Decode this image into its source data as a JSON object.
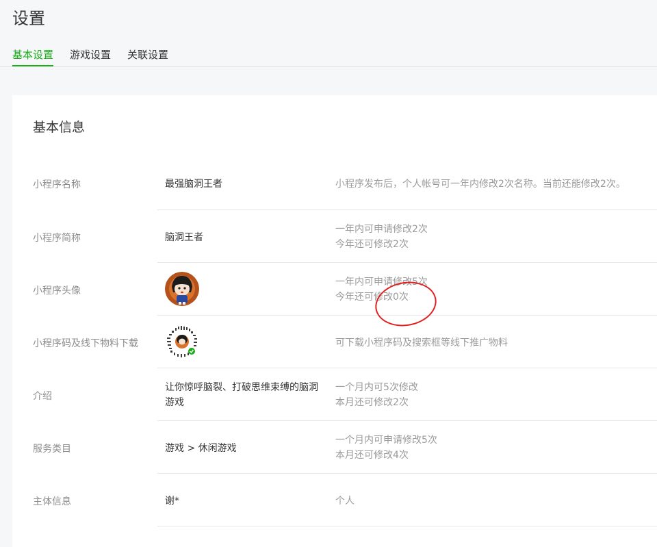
{
  "page": {
    "title": "设置"
  },
  "tabs": [
    {
      "label": "基本设置",
      "active": true
    },
    {
      "label": "游戏设置",
      "active": false
    },
    {
      "label": "关联设置",
      "active": false
    }
  ],
  "card": {
    "title": "基本信息",
    "rows": [
      {
        "label": "小程序名称",
        "value": "最强脑洞王者",
        "note": [
          "小程序发布后，个人帐号可一年内修改2次名称。当前还能修改2次。"
        ]
      },
      {
        "label": "小程序简称",
        "value": "脑洞王者",
        "note": [
          "一年内可申请修改2次",
          "今年还可修改2次"
        ]
      },
      {
        "label": "小程序头像",
        "value_icon": "cartoon-avatar",
        "note": [
          "一年内可申请修改5次",
          "今年还可修改0次"
        ]
      },
      {
        "label": "小程序码及线下物料下载",
        "value_icon": "mini-program-code",
        "note": [
          "可下载小程序码及搜索框等线下推广物料"
        ]
      },
      {
        "label": "介绍",
        "value_lines": [
          "让你惊呼脑裂、打破思维束缚的脑洞",
          "游戏"
        ],
        "note": [
          "一个月内可5次修改",
          "本月还可修改2次"
        ]
      },
      {
        "label": "服务类目",
        "value": "游戏 > 休闲游戏",
        "note": [
          "一个月内可申请修改5次",
          "本月还可修改4次"
        ]
      },
      {
        "label": "主体信息",
        "value": "谢*",
        "note": [
          "个人"
        ]
      }
    ]
  },
  "colors": {
    "accent": "#1aad19",
    "annotation": "#e02020"
  }
}
